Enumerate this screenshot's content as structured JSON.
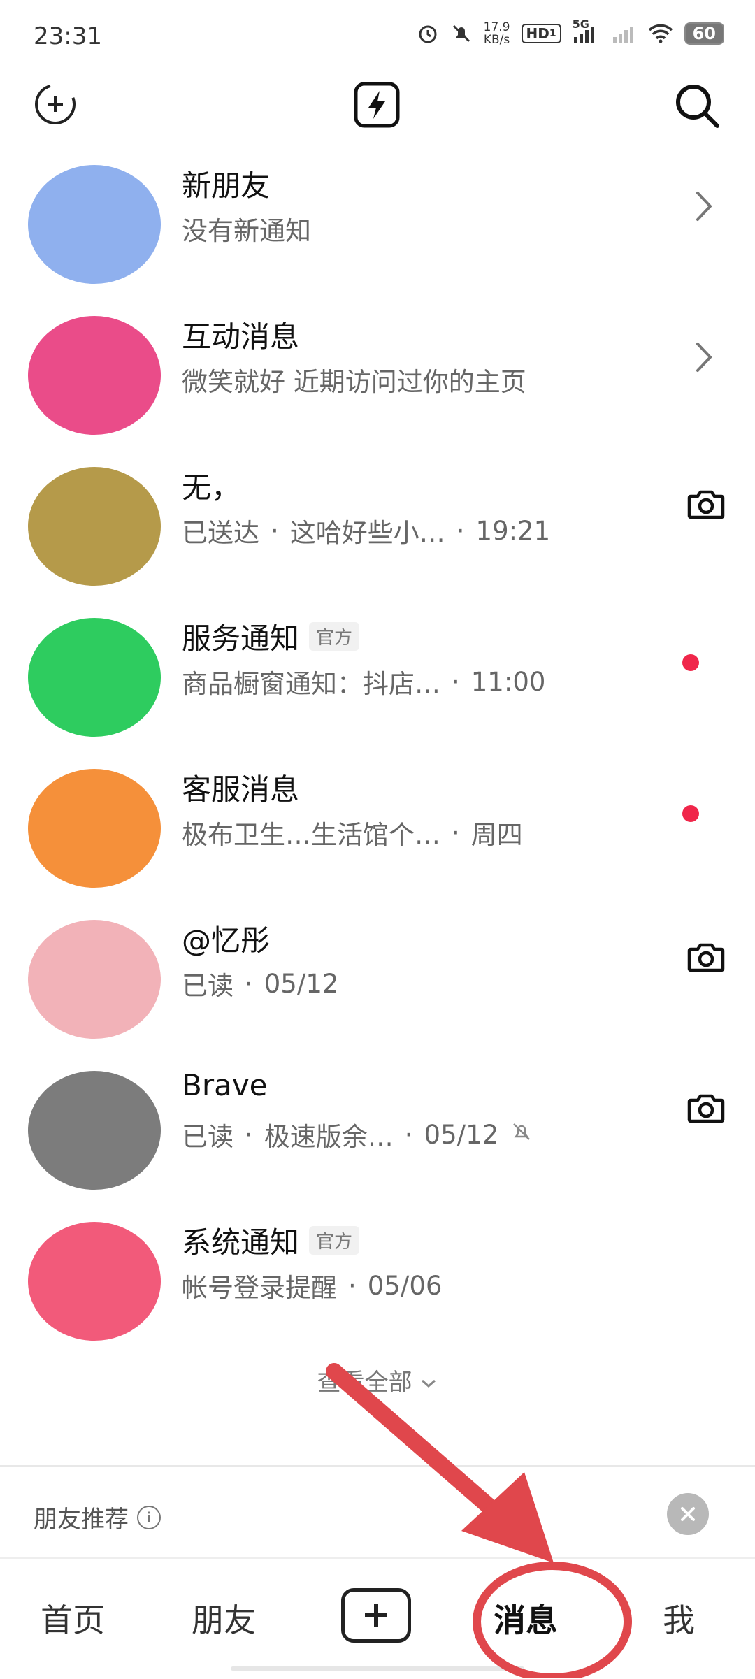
{
  "status_bar": {
    "time": "23:31",
    "net_speed_value": "17.9",
    "net_speed_unit": "KB/s",
    "hd_label": "HD",
    "hd_sub": "1",
    "network_label": "5G",
    "battery": "60"
  },
  "top_bar": {
    "left_icon": "add-circle-icon",
    "center_icon": "lightning-icon",
    "right_icon": "search-icon"
  },
  "messages": [
    {
      "title": "新朋友",
      "sub": "没有新通知",
      "trailing": "chevron",
      "avatar_color": "#8fb0ee"
    },
    {
      "title": "互动消息",
      "sub": "微笑就好 近期访问过你的主页",
      "trailing": "chevron",
      "avatar_color": "#ea4c89"
    },
    {
      "title": "无，",
      "sub_parts": [
        "已送达",
        "·",
        "这哈好些小…",
        "·",
        "19:21"
      ],
      "trailing": "camera",
      "avatar_color": "#b59a4a"
    },
    {
      "title": "服务通知",
      "tag": "官方",
      "sub_parts": [
        "商品橱窗通知：抖店…",
        "·",
        "11:00"
      ],
      "trailing": "dot",
      "avatar_color": "#2ecc5f"
    },
    {
      "title": "客服消息",
      "sub_parts": [
        "极布卫生…生活馆个…",
        "·",
        "周四"
      ],
      "trailing": "dot",
      "avatar_color": "#f5903a"
    },
    {
      "title": "@忆彤",
      "sub_parts": [
        "已读",
        "·",
        "05/12"
      ],
      "trailing": "camera",
      "avatar_color": "#f2b2b8"
    },
    {
      "title": "Brave",
      "sub_parts": [
        "已读",
        "·",
        "极速版余…",
        "·",
        "05/12"
      ],
      "muted": true,
      "trailing": "camera",
      "avatar_color": "#7c7c7c"
    },
    {
      "title": "系统通知",
      "tag": "官方",
      "sub_parts": [
        "帐号登录提醒",
        "·",
        "05/06"
      ],
      "trailing": "none",
      "avatar_color": "#f25a7a"
    }
  ],
  "view_all": "查看全部",
  "friends_recommend": {
    "label": "朋友推荐"
  },
  "nav": {
    "home": "首页",
    "friends": "朋友",
    "messages": "消息",
    "me": "我"
  },
  "annotation_color": "#e0474c"
}
